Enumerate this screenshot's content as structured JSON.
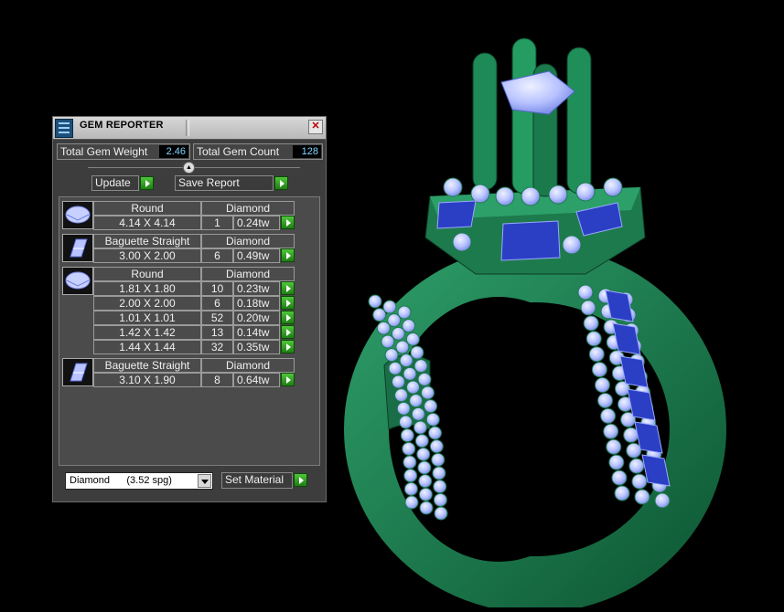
{
  "window": {
    "title": "GEM REPORTER",
    "close_glyph": "✕"
  },
  "totals": {
    "weight_label": "Total Gem Weight",
    "weight_value": "2.46",
    "count_label": "Total Gem Count",
    "count_value": "128"
  },
  "actions": {
    "update_label": "Update",
    "save_label": "Save Report"
  },
  "gem_groups": [
    {
      "shape": "Round",
      "material": "Diamond",
      "icon": "round-gem-icon",
      "rows": [
        {
          "size": "4.14 X 4.14",
          "count": "1",
          "weight": "0.24tw"
        }
      ]
    },
    {
      "shape": "Baguette Straight",
      "material": "Diamond",
      "icon": "baguette-gem-icon",
      "rows": [
        {
          "size": "3.00 X 2.00",
          "count": "6",
          "weight": "0.49tw"
        }
      ]
    },
    {
      "shape": "Round",
      "material": "Diamond",
      "icon": "round-gem-icon",
      "rows": [
        {
          "size": "1.81 X 1.80",
          "count": "10",
          "weight": "0.23tw"
        },
        {
          "size": "2.00 X 2.00",
          "count": "6",
          "weight": "0.18tw"
        },
        {
          "size": "1.01 X 1.01",
          "count": "52",
          "weight": "0.20tw"
        },
        {
          "size": "1.42 X 1.42",
          "count": "13",
          "weight": "0.14tw"
        },
        {
          "size": "1.44 X 1.44",
          "count": "32",
          "weight": "0.35tw"
        }
      ]
    },
    {
      "shape": "Baguette Straight",
      "material": "Diamond",
      "icon": "baguette-gem-icon",
      "rows": [
        {
          "size": "3.10 X 1.90",
          "count": "8",
          "weight": "0.64tw"
        }
      ]
    }
  ],
  "material": {
    "selected": "Diamond      (3.52 spg)",
    "set_label": "Set Material"
  },
  "colors": {
    "ring_metal": "#1f7a52",
    "gem_blue": "#2b3fc4",
    "gem_pale": "#b9c4ff",
    "panel_bg": "#3d3d3d",
    "accent_green": "#2e9f22"
  }
}
